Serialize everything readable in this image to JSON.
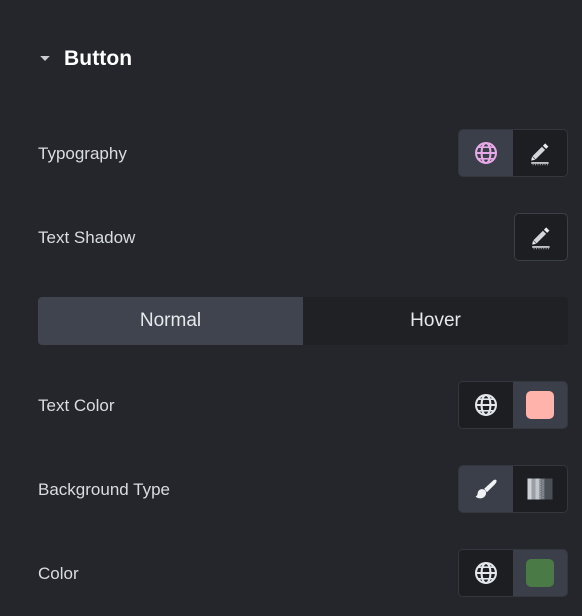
{
  "section": {
    "title": "Button",
    "collapse_icon": "chevron-down-icon",
    "expanded": true
  },
  "rows": {
    "typography": {
      "label": "Typography",
      "controls": [
        {
          "icon": "globe-icon",
          "state": "active",
          "color": "#e7a9e8"
        },
        {
          "icon": "pencil-edit-icon",
          "state": "default",
          "color": "#d7dade"
        }
      ]
    },
    "text_shadow": {
      "label": "Text Shadow",
      "controls": [
        {
          "icon": "pencil-edit-icon",
          "state": "default",
          "color": "#d7dade"
        }
      ]
    },
    "text_color": {
      "label": "Text Color",
      "controls": [
        {
          "icon": "globe-icon",
          "state": "default",
          "color": "#e3e6ea"
        },
        {
          "icon": "color-swatch",
          "state": "active",
          "color": "#ffb3ab"
        }
      ]
    },
    "background_type": {
      "label": "Background Type",
      "controls": [
        {
          "icon": "paint-brush-icon",
          "state": "active",
          "color": "#f0f2f4"
        },
        {
          "icon": "gradient-icon",
          "state": "default",
          "color": "#b9bdc2"
        }
      ]
    },
    "color": {
      "label": "Color",
      "controls": [
        {
          "icon": "globe-icon",
          "state": "default",
          "color": "#e3e6ea"
        },
        {
          "icon": "color-swatch",
          "state": "active",
          "color": "#4a7a46"
        }
      ]
    }
  },
  "state_tabs": {
    "selected": "Normal",
    "items": [
      {
        "label": "Normal",
        "active": true
      },
      {
        "label": "Hover",
        "active": false
      }
    ]
  },
  "theme": {
    "panel_background": "#24262b",
    "label_color": "#d9dce0",
    "title_color": "#ffffff",
    "cell_active_background": "#3a3f4a",
    "cell_default_background": "#1c1e22",
    "tab_active_background": "#3f444e",
    "tab_inactive_background": "#1f2124",
    "accent_globe_color": "#e7a9e8",
    "text_color_swatch": "#ffb3ab",
    "background_color_swatch": "#4a7a46"
  }
}
